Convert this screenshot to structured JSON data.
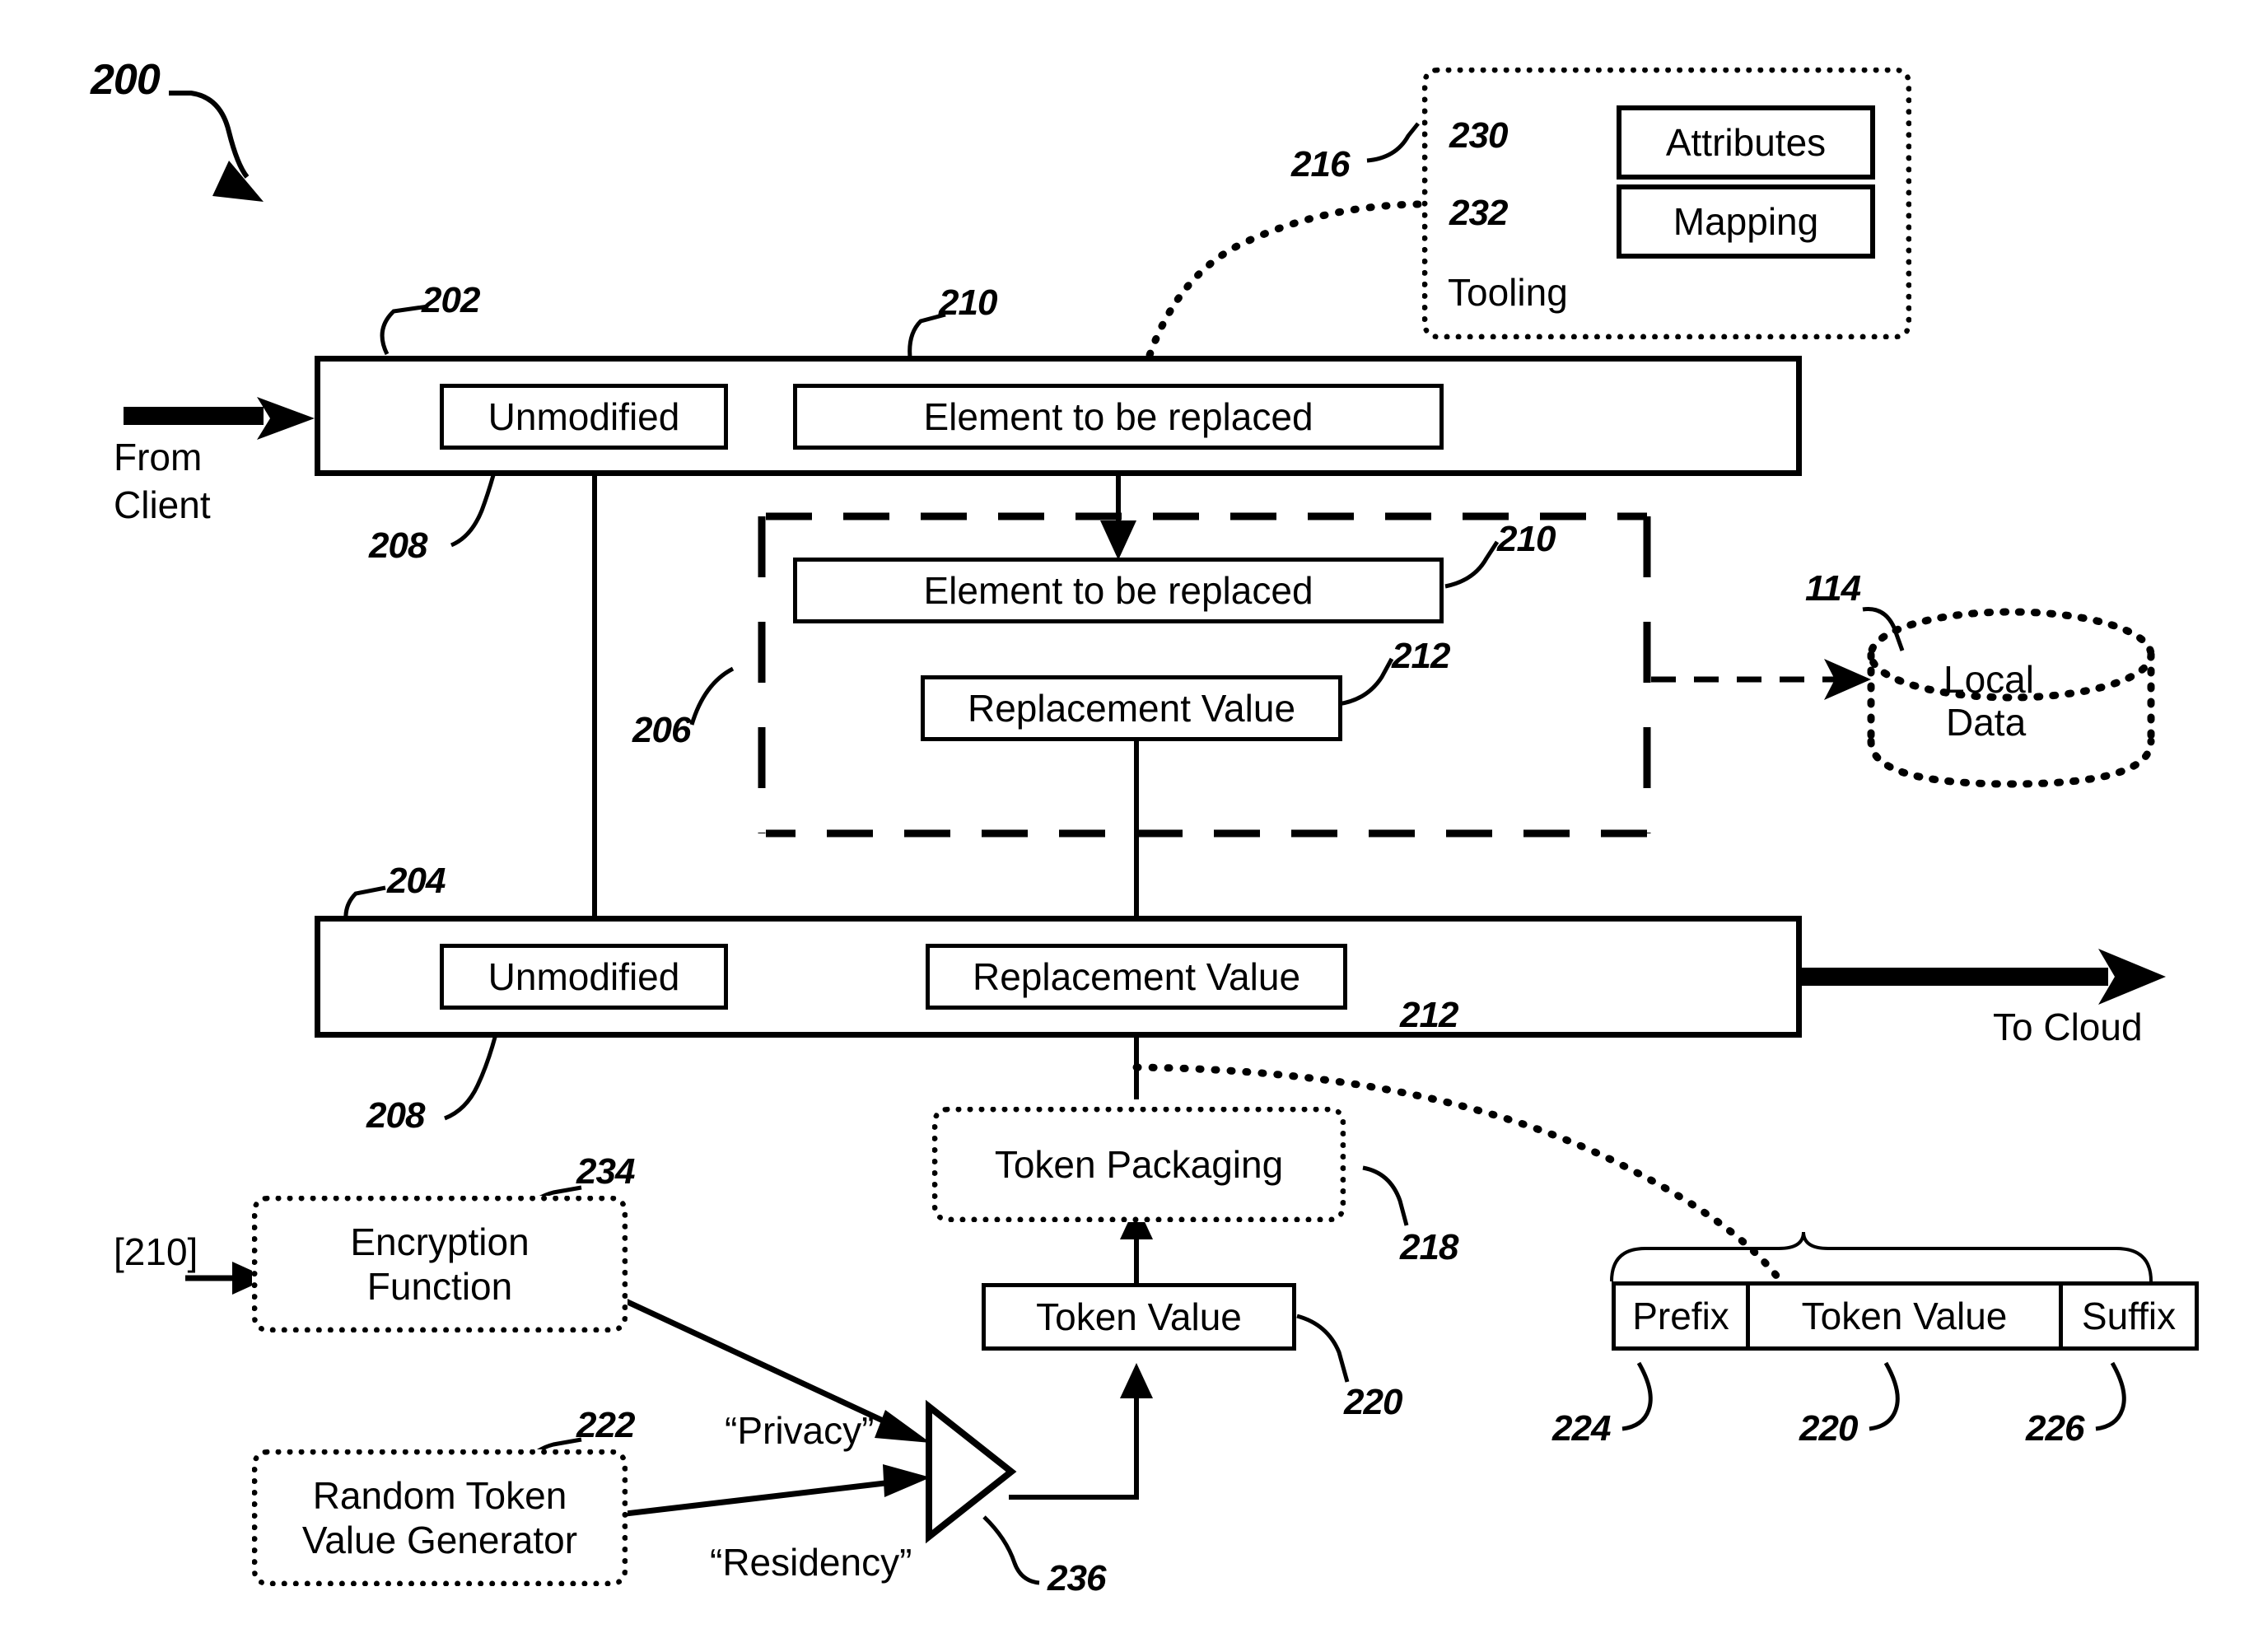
{
  "figure": {
    "number": "200",
    "type": "patent-flow-diagram"
  },
  "refs": {
    "fig": "200",
    "top_message": "202",
    "bottom_message": "204",
    "replacement_region": "206",
    "unmodified_top": "208",
    "unmodified_bottom": "208",
    "element_top": "210",
    "element_mid": "210",
    "element_input": "[210]",
    "replacement_value_mid": "212",
    "replacement_value_bottom": "212",
    "local_data": "114",
    "tooling": "216",
    "token_packaging": "218",
    "token_value": "220",
    "token_value_cell": "220",
    "random_generator": "222",
    "prefix": "224",
    "suffix": "226",
    "attributes": "230",
    "mapping": "232",
    "encryption_function": "234",
    "selector": "236"
  },
  "flow": {
    "from_client": "From\nClient",
    "from_client_line1": "From",
    "from_client_line2": "Client",
    "to_cloud": "To Cloud"
  },
  "tooling": {
    "title": "Tooling",
    "attributes": "Attributes",
    "mapping": "Mapping"
  },
  "top_message": {
    "unmodified": "Unmodified",
    "element": "Element to be replaced"
  },
  "replacement_region": {
    "element": "Element to be replaced",
    "replacement_value": "Replacement Value"
  },
  "bottom_message": {
    "unmodified": "Unmodified",
    "replacement_value": "Replacement Value"
  },
  "storage": {
    "local_data_line1": "Local",
    "local_data_line2": "Data"
  },
  "token_pipeline": {
    "token_packaging": "Token Packaging",
    "token_value": "Token Value"
  },
  "sources": {
    "encryption_function_line1": "Encryption",
    "encryption_function_line2": "Function",
    "encryption_input": "[210]",
    "random_generator_line1": "Random Token",
    "random_generator_line2": "Value Generator"
  },
  "selector_labels": {
    "privacy": "“Privacy”",
    "residency": "“Residency”"
  },
  "token_format": {
    "prefix": "Prefix",
    "token_value": "Token Value",
    "suffix": "Suffix"
  },
  "colors": {
    "stroke": "#000000",
    "background": "#ffffff"
  }
}
